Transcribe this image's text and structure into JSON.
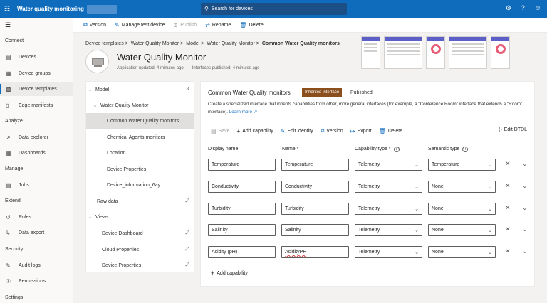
{
  "topbar": {
    "app_title": "Water quality monitoring",
    "search_placeholder": "Search for devices"
  },
  "sidebar": {
    "sections": [
      {
        "title": "Connect",
        "items": [
          {
            "label": "Devices"
          },
          {
            "label": "Device groups"
          },
          {
            "label": "Device templates",
            "active": true
          },
          {
            "label": "Edge manifests"
          }
        ]
      },
      {
        "title": "Analyze",
        "items": [
          {
            "label": "Data explorer"
          },
          {
            "label": "Dashboards"
          }
        ]
      },
      {
        "title": "Manage",
        "items": [
          {
            "label": "Jobs"
          }
        ]
      },
      {
        "title": "Extend",
        "items": [
          {
            "label": "Rules"
          },
          {
            "label": "Data export"
          }
        ]
      },
      {
        "title": "Security",
        "items": [
          {
            "label": "Audit logs"
          },
          {
            "label": "Permissions"
          }
        ]
      },
      {
        "title": "Settings",
        "items": []
      }
    ]
  },
  "toolbar": {
    "version": "Version",
    "manage_test_device": "Manage test device",
    "publish": "Publish",
    "rename": "Rename",
    "delete": "Delete"
  },
  "breadcrumb": [
    "Device templates",
    "Water Quality Monitor",
    "Model",
    "Water Quality Monitor",
    "Common Water Quality monitors"
  ],
  "header": {
    "title": "Water Quality Monitor",
    "app_updated": "Application updated: 4 minutes ago",
    "interfaces_published": "Interfaces published: 4 minutes ago"
  },
  "tree": {
    "model": "Model",
    "water_quality_monitor": "Water Quality Monitor",
    "common": "Common Water Quality monitors",
    "chemical": "Chemical Agents monitors",
    "location": "Location",
    "device_properties": "Device Properties",
    "device_information": "Device_information_6ay",
    "raw_data": "Raw data",
    "views": "Views",
    "device_dashboard": "Device Dashboard",
    "cloud_properties": "Cloud Properties",
    "device_properties_view": "Device Properties"
  },
  "editor": {
    "title": "Common Water Quality monitors",
    "badge": "Inherited interface",
    "status": "Published",
    "description": "Create a specialized interface that inherits capabilities from other, more general interfaces (for example, a \"Conference Room\" interface that extends a \"Room\" interface).",
    "learn_more": "Learn more",
    "commands": {
      "save": "Save",
      "add_capability": "Add capability",
      "edit_identity": "Edit identity",
      "version": "Version",
      "export": "Export",
      "delete": "Delete",
      "edit_dtdl": "Edit DTDL"
    },
    "columns": {
      "display_name": "Display name",
      "name": "Name *",
      "capability_type": "Capability type *",
      "semantic_type": "Semantic type"
    },
    "rows": [
      {
        "display_name": "Temperature",
        "name": "Temperature",
        "capability_type": "Telemetry",
        "semantic_type": "Temperature"
      },
      {
        "display_name": "Conductivity",
        "name": "Conductivity",
        "capability_type": "Telemetry",
        "semantic_type": "None"
      },
      {
        "display_name": "Turbidity",
        "name": "Turbidity",
        "capability_type": "Telemetry",
        "semantic_type": "None"
      },
      {
        "display_name": "Salinity",
        "name": "Salinity",
        "capability_type": "Telemetry",
        "semantic_type": "None"
      },
      {
        "display_name": "Acidity (pH)",
        "name": "AcidityPH",
        "capability_type": "Telemetry",
        "semantic_type": "None"
      }
    ],
    "add_capability": "Add capability"
  }
}
